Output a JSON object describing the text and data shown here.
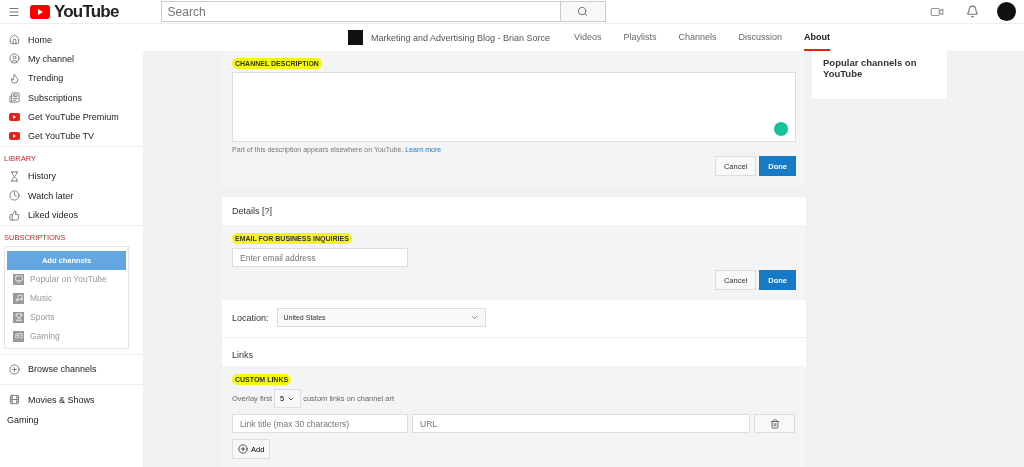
{
  "header": {
    "logo": "YouTube",
    "search": {
      "placeholder": "Search"
    }
  },
  "sidebar": {
    "main": [
      {
        "label": "Home"
      },
      {
        "label": "My channel"
      },
      {
        "label": "Trending"
      },
      {
        "label": "Subscriptions"
      },
      {
        "label": "Get YouTube Premium"
      },
      {
        "label": "Get YouTube TV"
      }
    ],
    "library_title": "LIBRARY",
    "library": [
      {
        "label": "History"
      },
      {
        "label": "Watch later"
      },
      {
        "label": "Liked videos"
      }
    ],
    "subscriptions_title": "SUBSCRIPTIONS",
    "add_channels": "Add channels",
    "subscriptions": [
      {
        "label": "Popular on YouTube"
      },
      {
        "label": "Music"
      },
      {
        "label": "Sports"
      },
      {
        "label": "Gaming"
      }
    ],
    "browse": {
      "label": "Browse channels"
    },
    "more": [
      {
        "label": "Movies & Shows",
        "kind": "item"
      },
      {
        "label": "Gaming",
        "kind": "plain"
      }
    ]
  },
  "channel_nav": {
    "channel_name": "Marketing and Advertising Blog - Brian Sorce",
    "tabs": [
      {
        "label": "Videos",
        "selected": false
      },
      {
        "label": "Playlists",
        "selected": false
      },
      {
        "label": "Channels",
        "selected": false
      },
      {
        "label": "Discussion",
        "selected": false
      },
      {
        "label": "About",
        "selected": true
      }
    ]
  },
  "description": {
    "label": "CHANNEL DESCRIPTION",
    "highlighted": true,
    "help": "Part of this description appears elsewhere on YouTube.",
    "link": "Learn more",
    "buttons": [
      "Cancel",
      "Done"
    ]
  },
  "details": {
    "title": "Details [?]",
    "email_label": "EMAIL FOR BUSINESS INQUIRIES",
    "email_highlighted": true,
    "email_placeholder": "Enter email address",
    "buttons": [
      "Cancel",
      "Done"
    ],
    "location_label": "Location:",
    "location_value": "United States"
  },
  "links": {
    "title": "Links",
    "label": "CUSTOM LINKS",
    "highlighted": true,
    "overlay_before": "Overlay first",
    "overlay_count": "5",
    "overlay_after": "custom links on channel art",
    "title_placeholder": "Link title (max 30 characters)",
    "url_placeholder": "URL",
    "add": "Add"
  },
  "right_card": {
    "title": "Popular channels on YouTube"
  }
}
